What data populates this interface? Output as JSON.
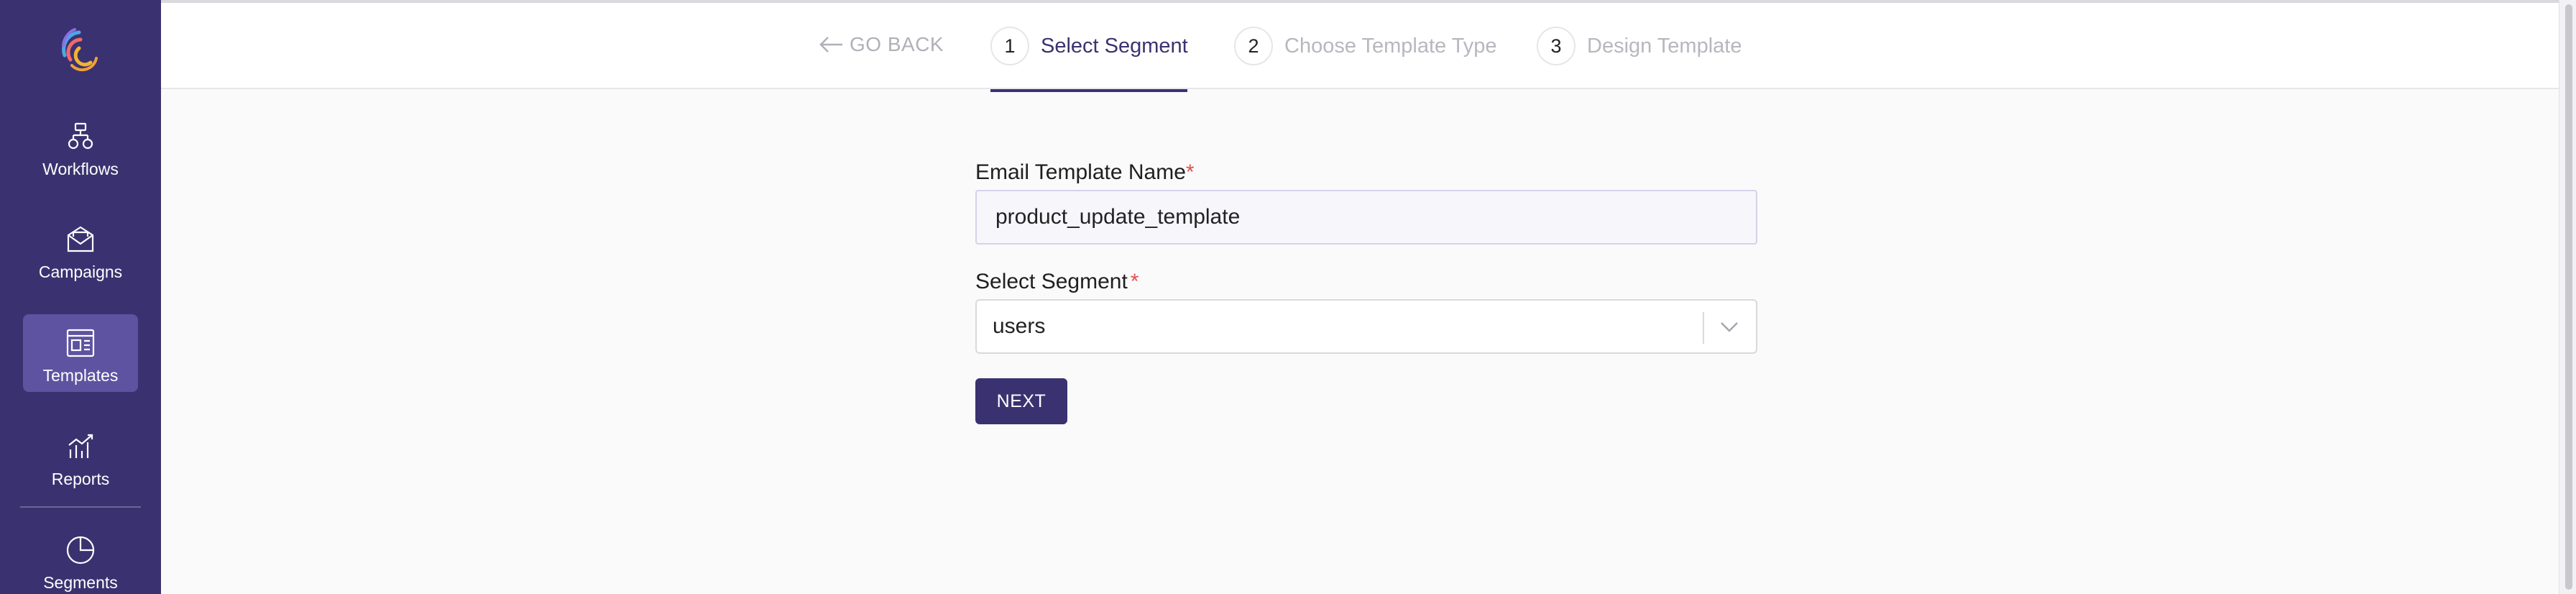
{
  "sidebar": {
    "items": [
      {
        "label": "Workflows",
        "icon": "workflow-icon"
      },
      {
        "label": "Campaigns",
        "icon": "envelope-icon"
      },
      {
        "label": "Templates",
        "icon": "template-icon",
        "active": true
      },
      {
        "label": "Reports",
        "icon": "chart-icon"
      },
      {
        "label": "Segments",
        "icon": "pie-icon"
      }
    ]
  },
  "header": {
    "go_back": "GO BACK",
    "steps": [
      {
        "num": "1",
        "label": "Select Segment",
        "active": true
      },
      {
        "num": "2",
        "label": "Choose Template Type"
      },
      {
        "num": "3",
        "label": "Design Template"
      }
    ]
  },
  "form": {
    "name_label": "Email Template Name",
    "name_required": "*",
    "name_value": "product_update_template",
    "segment_label": "Select Segment",
    "segment_required": "*",
    "segment_value": "users",
    "next_label": "NEXT"
  },
  "colors": {
    "sidebar_bg": "#3a3270",
    "active_item_bg": "#5d53a0",
    "accent": "#3a3270",
    "required": "#e05050"
  }
}
